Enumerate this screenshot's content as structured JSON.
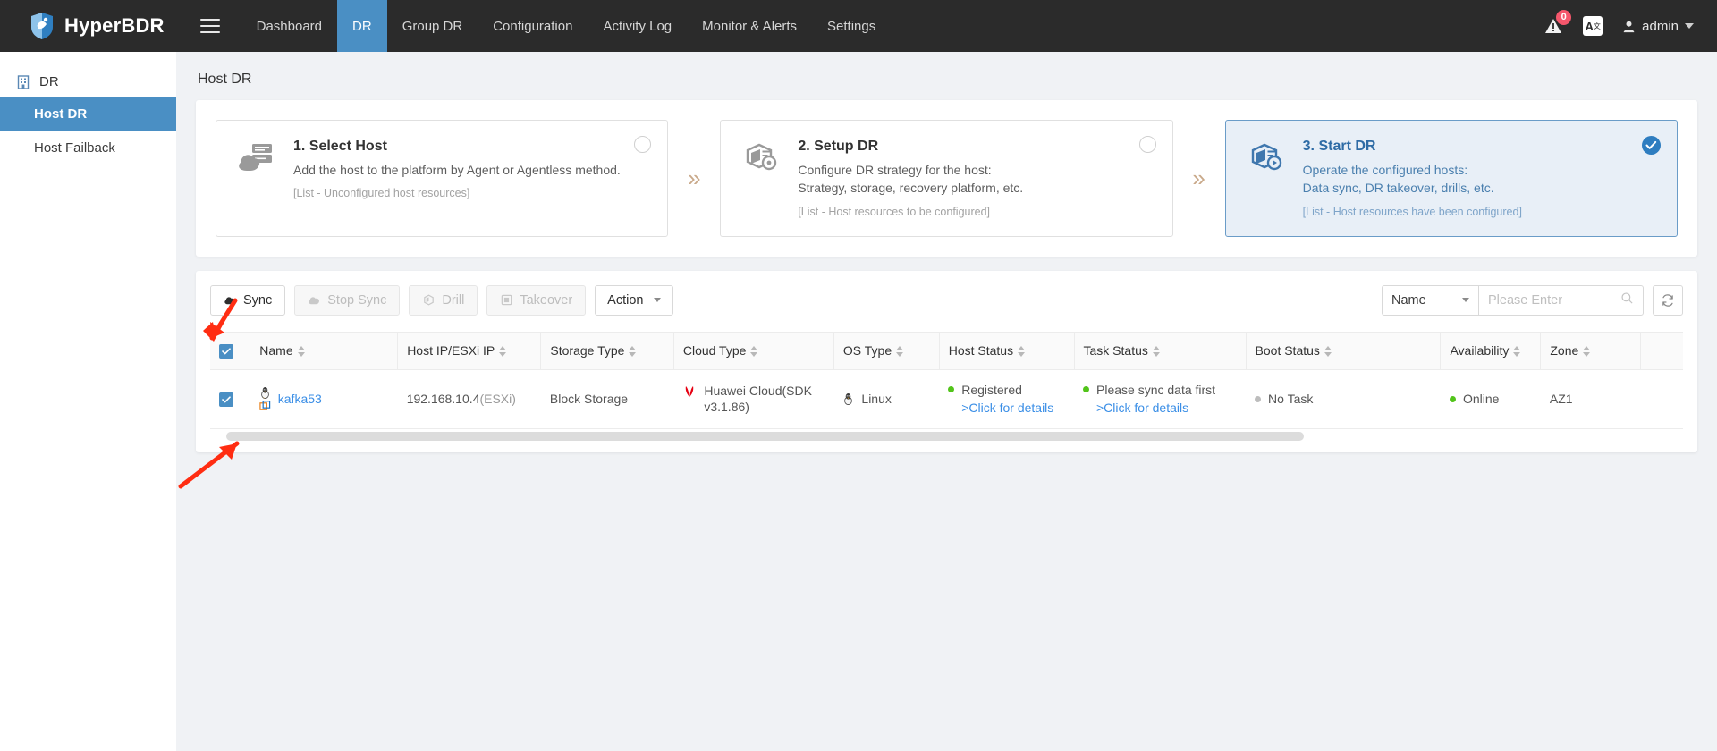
{
  "header": {
    "brand": "HyperBDR",
    "menu_icon": "hamburger-icon",
    "nav": [
      {
        "label": "Dashboard",
        "active": false
      },
      {
        "label": "DR",
        "active": true
      },
      {
        "label": "Group DR",
        "active": false
      },
      {
        "label": "Configuration",
        "active": false
      },
      {
        "label": "Activity Log",
        "active": false
      },
      {
        "label": "Monitor & Alerts",
        "active": false
      },
      {
        "label": "Settings",
        "active": false
      }
    ],
    "alert_badge": "0",
    "lang_label": "A",
    "lang_sup": "文",
    "user": "admin",
    "accent": "#4a8fc4"
  },
  "sidebar": {
    "group_label": "DR",
    "items": [
      {
        "label": "Host DR",
        "active": true
      },
      {
        "label": "Host Failback",
        "active": false
      }
    ]
  },
  "page": {
    "title": "Host DR"
  },
  "steps": [
    {
      "title": "1. Select Host",
      "desc": [
        "Add the host to the platform by Agent or Agentless method."
      ],
      "note": "[List - Unconfigured host resources]",
      "state": "incomplete",
      "icon": "host-cloud-icon"
    },
    {
      "title": "2. Setup DR",
      "desc": [
        "Configure DR strategy for the host:",
        "Strategy, storage, recovery platform, etc."
      ],
      "note": "[List - Host resources to be configured]",
      "state": "incomplete",
      "icon": "dr-setup-icon"
    },
    {
      "title": "3. Start DR",
      "desc": [
        "Operate the configured hosts:",
        "Data sync, DR takeover, drills, etc."
      ],
      "note": "[List - Host resources have been configured]",
      "state": "complete",
      "icon": "dr-start-icon"
    }
  ],
  "step_separator": "»",
  "toolbar": {
    "buttons": [
      {
        "label": "Sync",
        "icon": "cloud-up-icon",
        "disabled": false
      },
      {
        "label": "Stop Sync",
        "icon": "cloud-stop-icon",
        "disabled": true
      },
      {
        "label": "Drill",
        "icon": "drill-box-icon",
        "disabled": true
      },
      {
        "label": "Takeover",
        "icon": "takeover-icon",
        "disabled": true
      }
    ],
    "action_label": "Action",
    "filter_field": "Name",
    "search_placeholder": "Please Enter",
    "search_value": "",
    "refresh_icon": "refresh-icon"
  },
  "table": {
    "columns": [
      {
        "label": "Name",
        "sortable": true
      },
      {
        "label": "Host IP/ESXi IP",
        "sortable": true
      },
      {
        "label": "Storage Type",
        "sortable": true
      },
      {
        "label": "Cloud Type",
        "sortable": true
      },
      {
        "label": "OS Type",
        "sortable": true
      },
      {
        "label": "Host Status",
        "sortable": true
      },
      {
        "label": "Task Status",
        "sortable": true
      },
      {
        "label": "Boot Status",
        "sortable": true
      },
      {
        "label": "Availability",
        "sortable": true
      },
      {
        "label": "Zone",
        "sortable": true
      }
    ],
    "header_checkbox_checked": true,
    "rows": [
      {
        "checked": true,
        "name": "kafka53",
        "name_icons": [
          "linux-penguin-icon",
          "vmware-icon"
        ],
        "host_ip": "192.168.10.4",
        "host_ip_suffix": "(ESXi)",
        "storage_type": "Block Storage",
        "cloud_type": "Huawei Cloud(SDK v3.1.86)",
        "cloud_icon": "huawei-logo-icon",
        "os_type": "Linux",
        "os_icon": "linux-penguin-icon",
        "host_status": "Registered",
        "host_status_link": ">Click for details",
        "host_status_dot": "green",
        "task_status": "Please sync data first",
        "task_status_link": ">Click for details",
        "task_status_dot": "green",
        "boot_status": "No Task",
        "boot_status_dot": "grey",
        "availability": "Online",
        "availability_dot": "green",
        "zone": "AZ1"
      }
    ]
  },
  "annotations": [
    {
      "name": "arrow-pointing-to-sync-button",
      "color": "#ff2d12"
    },
    {
      "name": "arrow-pointing-to-row-checkbox",
      "color": "#ff2d12"
    }
  ]
}
